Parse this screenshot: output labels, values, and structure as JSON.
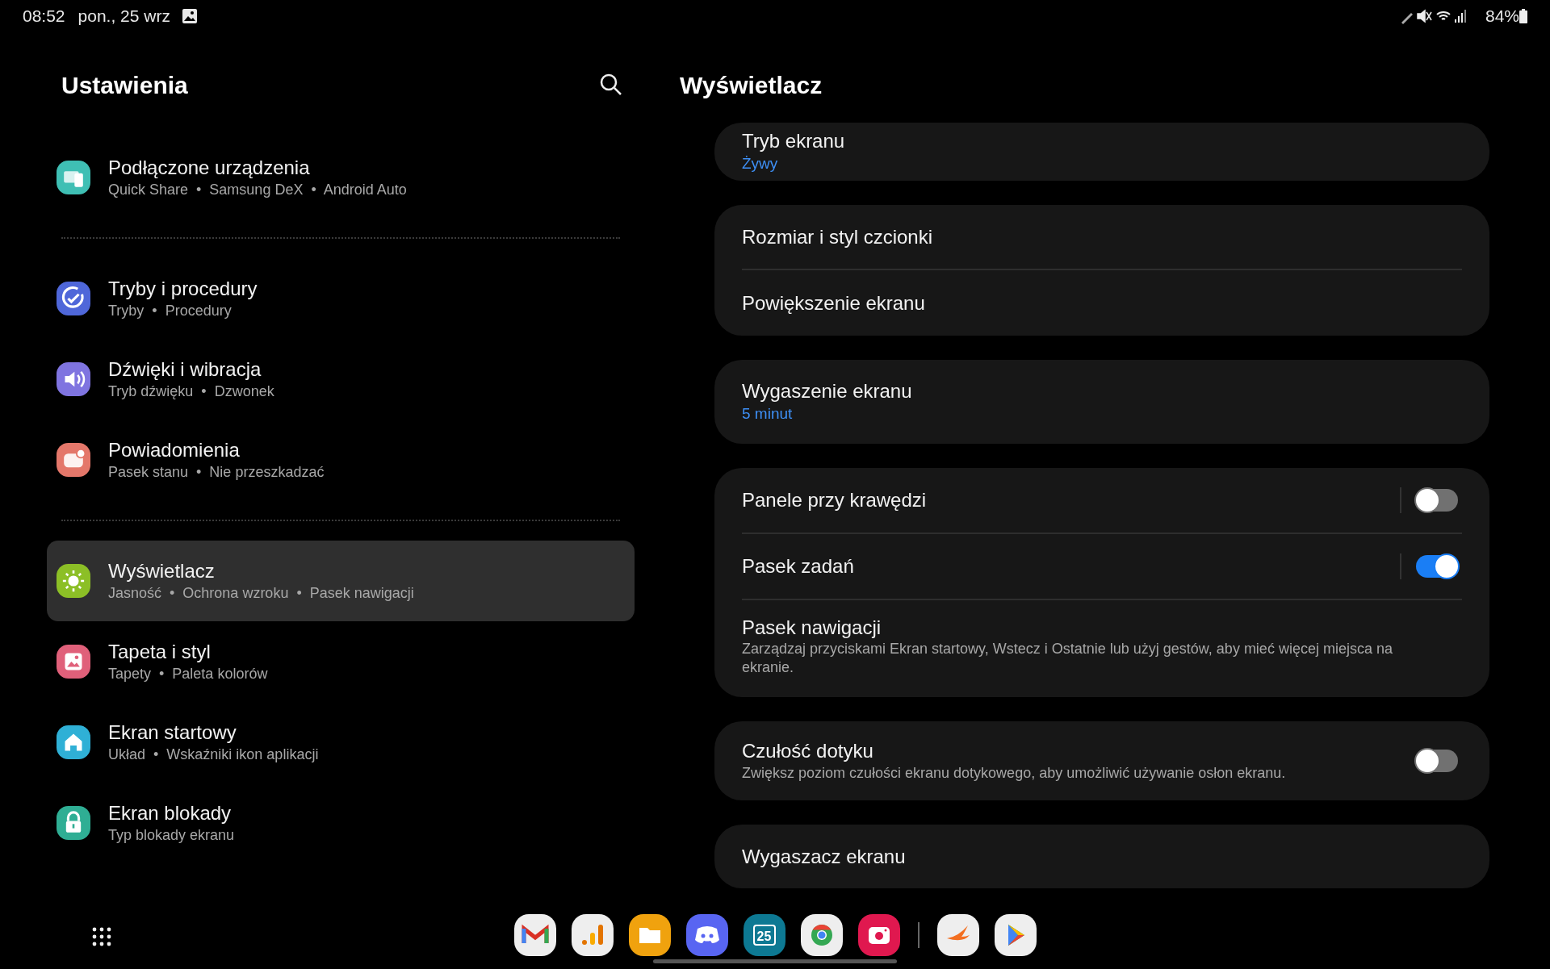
{
  "status_bar": {
    "time": "08:52",
    "date": "pon., 25 wrz",
    "battery": "84%"
  },
  "settings": {
    "title": "Ustawienia",
    "groups": [
      [
        {
          "kind": "devices",
          "color": "#3fbfb4",
          "label": "Podłączone urządzenia",
          "subtitle": "Quick Share  •  Samsung DeX  •  Android Auto",
          "selected": false
        }
      ],
      [
        {
          "kind": "routines",
          "color": "#4f67d9",
          "label": "Tryby i procedury",
          "subtitle": "Tryby  •  Procedury",
          "selected": false
        },
        {
          "kind": "sound",
          "color": "#7f74e0",
          "label": "Dźwięki i wibracja",
          "subtitle": "Tryb dźwięku  •  Dzwonek",
          "selected": false
        },
        {
          "kind": "notify",
          "color": "#e4776a",
          "label": "Powiadomienia",
          "subtitle": "Pasek stanu  •  Nie przeszkadzać",
          "selected": false
        }
      ],
      [
        {
          "kind": "sun",
          "color": "#8cbf26",
          "label": "Wyświetlacz",
          "subtitle": "Jasność  •  Ochrona wzroku  •  Pasek nawigacji",
          "selected": true
        },
        {
          "kind": "picture",
          "color": "#e0607a",
          "label": "Tapeta i styl",
          "subtitle": "Tapety  •  Paleta kolorów",
          "selected": false
        },
        {
          "kind": "home",
          "color": "#2fb0d6",
          "label": "Ekran startowy",
          "subtitle": "Układ  •  Wskaźniki ikon aplikacji",
          "selected": false
        },
        {
          "kind": "lock",
          "color": "#2fae94",
          "label": "Ekran blokady",
          "subtitle": "Typ blokady ekranu",
          "selected": false
        }
      ]
    ]
  },
  "display": {
    "title": "Wyświetlacz",
    "cards": [
      [
        {
          "kind": "value",
          "label": "Tryb ekranu",
          "value": "Żywy"
        }
      ],
      [
        {
          "kind": "plain",
          "label": "Rozmiar i styl czcionki"
        },
        {
          "kind": "plain",
          "label": "Powiększenie ekranu"
        }
      ],
      [
        {
          "kind": "value",
          "label": "Wygaszenie ekranu",
          "value": "5 minut"
        }
      ],
      [
        {
          "kind": "toggle",
          "label": "Panele przy krawędzi",
          "on": false
        },
        {
          "kind": "toggle",
          "label": "Pasek zadań",
          "on": true
        },
        {
          "kind": "description",
          "label": "Pasek nawigacji",
          "description": "Zarządzaj przyciskami Ekran startowy, Wstecz i Ostatnie lub użyj gestów, aby mieć więcej miejsca na ekranie."
        }
      ],
      [
        {
          "kind": "toggle_description",
          "label": "Czułość dotyku",
          "description": "Zwiększ poziom czułości ekranu dotykowego, aby umożliwić używanie osłon ekranu.",
          "on": false
        }
      ],
      [
        {
          "kind": "plain",
          "label": "Wygaszacz ekranu"
        }
      ]
    ]
  },
  "dock": {
    "apps": [
      {
        "kind": "mail"
      },
      {
        "kind": "chart"
      },
      {
        "kind": "folder"
      },
      {
        "kind": "controller"
      },
      {
        "kind": "calendar",
        "text": "25"
      },
      {
        "kind": "browser"
      },
      {
        "kind": "camera"
      },
      {
        "kind": "divider"
      },
      {
        "kind": "bird"
      },
      {
        "kind": "play"
      }
    ]
  }
}
